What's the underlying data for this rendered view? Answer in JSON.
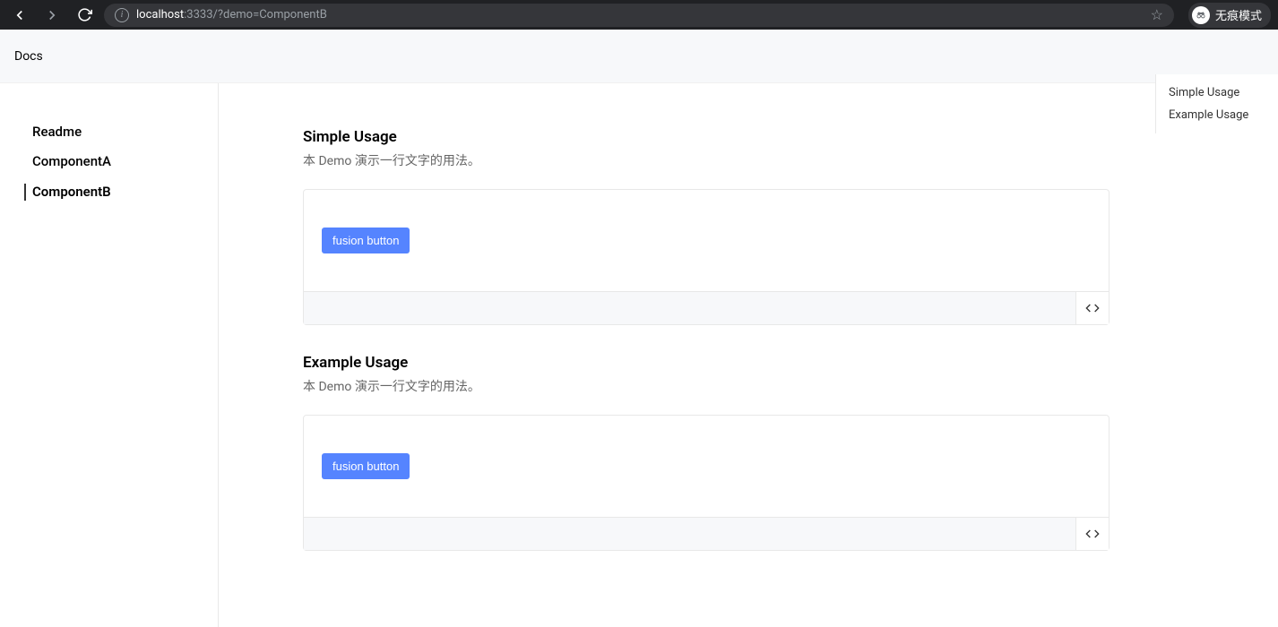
{
  "browser": {
    "url_host": "localhost",
    "url_rest": ":3333/?demo=ComponentB",
    "incognito_label": "无痕模式"
  },
  "header": {
    "title": "Docs"
  },
  "sidebar": {
    "items": [
      {
        "label": "Readme",
        "active": false
      },
      {
        "label": "ComponentA",
        "active": false
      },
      {
        "label": "ComponentB",
        "active": true
      }
    ]
  },
  "main": {
    "sections": [
      {
        "title": "Simple Usage",
        "description": "本 Demo 演示一行文字的用法。",
        "button_label": "fusion button"
      },
      {
        "title": "Example Usage",
        "description": "本 Demo 演示一行文字的用法。",
        "button_label": "fusion button"
      }
    ]
  },
  "toc": {
    "items": [
      {
        "label": "Simple Usage"
      },
      {
        "label": "Example Usage"
      }
    ]
  }
}
